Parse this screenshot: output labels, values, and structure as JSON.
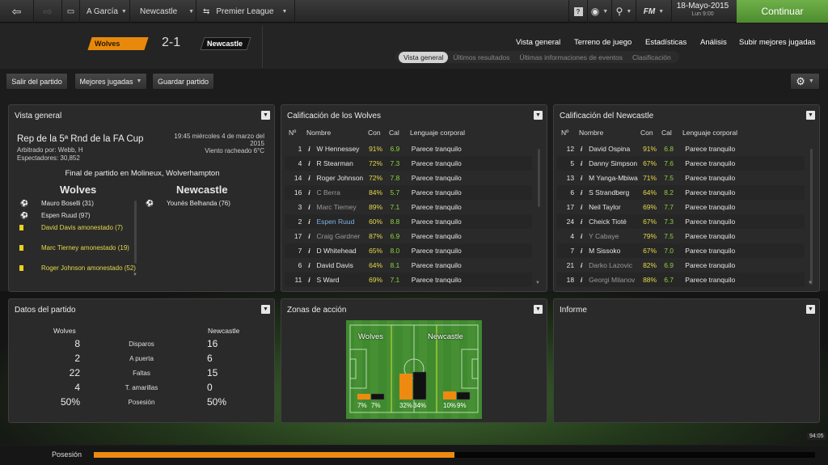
{
  "topbar": {
    "club": "A García",
    "team": "Newcastle",
    "competition": "Premier League",
    "fm": "FM",
    "date": "18-Mayo-2015",
    "day_time": "Lun 9:00",
    "continue": "Continuar"
  },
  "match": {
    "home": "Wolves",
    "away": "Newcastle",
    "score": "2-1"
  },
  "nav": [
    "Vista general",
    "Terreno de juego",
    "Estadísticas",
    "Análisis",
    "Subir mejores jugadas"
  ],
  "subnav": [
    "Vista general",
    "Últimos resultados",
    "Últimas informaciones de eventos",
    "Clasificación"
  ],
  "actions": {
    "leave": "Salir del partido",
    "highlights": "Mejores jugadas",
    "save": "Guardar partido"
  },
  "overview": {
    "title": "Vista general",
    "comp": "Rep de la 5ª Rnd de la FA Cup",
    "referee": "Arbitrado por: Webb, H",
    "attendance": "Espectadores: 30,852",
    "datetime": "19:45 miércoles 4 de marzo del 2015",
    "weather": "Viento racheado 6°C",
    "venue": "Final de partido en Molineux, Wolverhampton",
    "home": "Wolves",
    "away": "Newcastle",
    "home_events": [
      {
        "t": "Mauro Boselli (31)",
        "k": "goal"
      },
      {
        "t": "Espen Ruud (97)",
        "k": "goal"
      },
      {
        "t": "David Davis amonestado (7)",
        "k": "card"
      },
      {
        "t": "Marc Tierney amonestado (19)",
        "k": "card"
      },
      {
        "t": "Roger Johnson amonestado (52)",
        "k": "card"
      }
    ],
    "away_events": [
      {
        "t": "Younès Belhanda (76)",
        "k": "goal"
      }
    ]
  },
  "ratings_headers": {
    "n": "Nº",
    "name": "Nombre",
    "con": "Con",
    "cal": "Cal",
    "body": "Lenguaje corporal"
  },
  "wolves": {
    "title": "Calificación de los Wolves",
    "rows": [
      {
        "n": "1",
        "name": "W Hennessey",
        "con": "91%",
        "cal": "6.9",
        "body": "Parece tranquilo",
        "s": ""
      },
      {
        "n": "4",
        "name": "R Stearman",
        "con": "72%",
        "cal": "7.3",
        "body": "Parece tranquilo",
        "s": ""
      },
      {
        "n": "14",
        "name": "Roger Johnson",
        "con": "72%",
        "cal": "7.8",
        "body": "Parece tranquilo",
        "s": ""
      },
      {
        "n": "16",
        "name": "C Berra",
        "con": "84%",
        "cal": "5.7",
        "body": "Parece tranquilo",
        "s": "dim"
      },
      {
        "n": "3",
        "name": "Marc Tierney",
        "con": "89%",
        "cal": "7.1",
        "body": "Parece tranquilo",
        "s": "dim"
      },
      {
        "n": "2",
        "name": "Espen Ruud",
        "con": "60%",
        "cal": "8.8",
        "body": "Parece tranquilo",
        "s": "blu"
      },
      {
        "n": "17",
        "name": "Craig Gardner",
        "con": "87%",
        "cal": "6.9",
        "body": "Parece tranquilo",
        "s": "dim"
      },
      {
        "n": "7",
        "name": "D Whitehead",
        "con": "65%",
        "cal": "8.0",
        "body": "Parece tranquilo",
        "s": ""
      },
      {
        "n": "6",
        "name": "David Davis",
        "con": "64%",
        "cal": "8.1",
        "body": "Parece tranquilo",
        "s": ""
      },
      {
        "n": "11",
        "name": "S Ward",
        "con": "69%",
        "cal": "7.1",
        "body": "Parece tranquilo",
        "s": ""
      }
    ]
  },
  "newcastle": {
    "title": "Calificación del Newcastle",
    "rows": [
      {
        "n": "12",
        "name": "David Ospina",
        "con": "91%",
        "cal": "6.8",
        "body": "Parece tranquilo",
        "s": ""
      },
      {
        "n": "5",
        "name": "Danny Simpson",
        "con": "67%",
        "cal": "7.6",
        "body": "Parece tranquilo",
        "s": ""
      },
      {
        "n": "13",
        "name": "M Yanga-Mbiwa",
        "con": "71%",
        "cal": "7.5",
        "body": "Parece tranquilo",
        "s": ""
      },
      {
        "n": "6",
        "name": "S Strandberg",
        "con": "64%",
        "cal": "8.2",
        "body": "Parece tranquilo",
        "s": ""
      },
      {
        "n": "17",
        "name": "Neil Taylor",
        "con": "69%",
        "cal": "7.7",
        "body": "Parece tranquilo",
        "s": ""
      },
      {
        "n": "24",
        "name": "Cheick Tioté",
        "con": "67%",
        "cal": "7.3",
        "body": "Parece tranquilo",
        "s": ""
      },
      {
        "n": "4",
        "name": "Y Cabaye",
        "con": "79%",
        "cal": "7.5",
        "body": "Parece tranquilo",
        "s": "dim"
      },
      {
        "n": "7",
        "name": "M Sissoko",
        "con": "67%",
        "cal": "7.0",
        "body": "Parece tranquilo",
        "s": ""
      },
      {
        "n": "21",
        "name": "Darko Lazovic",
        "con": "82%",
        "cal": "6.9",
        "body": "Parece tranquilo",
        "s": "dim"
      },
      {
        "n": "18",
        "name": "Georgi Milanov",
        "con": "88%",
        "cal": "6.7",
        "body": "Parece tranquilo",
        "s": "dim"
      }
    ]
  },
  "stats": {
    "title": "Datos del partido",
    "home": "Wolves",
    "away": "Newcastle",
    "rows": [
      {
        "h": "8",
        "label": "Disparos",
        "a": "16"
      },
      {
        "h": "2",
        "label": "A puerta",
        "a": "6"
      },
      {
        "h": "22",
        "label": "Faltas",
        "a": "15"
      },
      {
        "h": "4",
        "label": "T. amarillas",
        "a": "0"
      },
      {
        "h": "50%",
        "label": "Posesión",
        "a": "50%"
      }
    ]
  },
  "zones": {
    "title": "Zonas de acción",
    "home": "Wolves",
    "away": "Newcastle",
    "values": [
      {
        "h": "7%",
        "a": "7%",
        "hv": 7,
        "av": 7
      },
      {
        "h": "32%",
        "a": "34%",
        "hv": 32,
        "av": 34
      },
      {
        "h": "10%",
        "a": "9%",
        "hv": 10,
        "av": 9
      }
    ]
  },
  "report": {
    "title": "Informe"
  },
  "bottom": {
    "label": "Posesión",
    "possession": 0.5,
    "clock": "94:05"
  },
  "colors": {
    "home": "#ee8a10",
    "away": "#111111",
    "accent_green": "#5da03a"
  }
}
